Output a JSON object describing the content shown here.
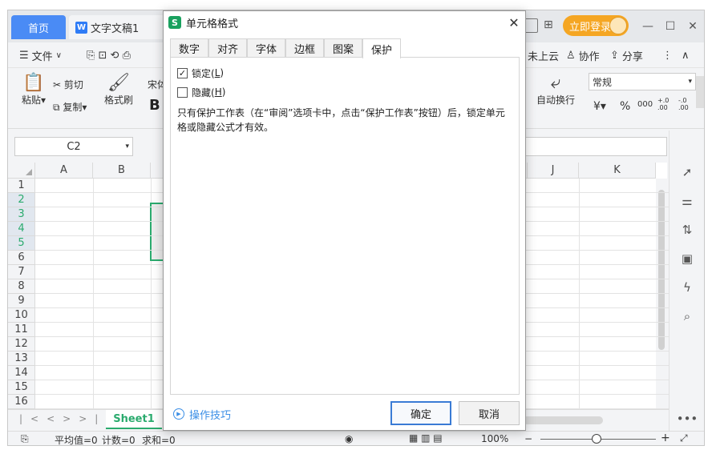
{
  "tabs": {
    "home": "首页",
    "doc": "文字文稿1"
  },
  "titlebar": {
    "login": "立即登录"
  },
  "menu": {
    "file": "文件",
    "cloud": "未上云",
    "collab": "协作",
    "share": "分享"
  },
  "ribbon": {
    "paste": "粘贴",
    "cut": "剪切",
    "copy": "复制",
    "format_painter": "格式刷",
    "font_partial": "宋体",
    "bold": "B",
    "wrap_text": "自动换行",
    "number_format": "常规",
    "currency": "¥",
    "percent": "%",
    "thousands": "000",
    "inc_decimal": "+.0\n.00",
    "dec_decimal": "-.0\n.00"
  },
  "formula": {
    "namebox": "C2"
  },
  "grid": {
    "columns": [
      "A",
      "B",
      "J",
      "K"
    ],
    "rows": [
      "1",
      "2",
      "3",
      "4",
      "5",
      "6",
      "7",
      "8",
      "9",
      "10",
      "11",
      "12",
      "13",
      "14",
      "15",
      "16"
    ],
    "selected_rows": [
      "2",
      "3",
      "4",
      "5"
    ]
  },
  "sheetbar": {
    "sheet1": "Sheet1"
  },
  "statusbar": {
    "avg": "平均值=0",
    "count": "计数=0",
    "sum": "求和=0",
    "zoom": "100%"
  },
  "dialog": {
    "title": "单元格格式",
    "tabs": [
      "数字",
      "对齐",
      "字体",
      "边框",
      "图案",
      "保护"
    ],
    "active_tab": "保护",
    "lock": {
      "label": "锁定(",
      "key": "L",
      "suffix": ")",
      "checked": true
    },
    "hide": {
      "label": "隐藏(",
      "key": "H",
      "suffix": ")",
      "checked": false
    },
    "description": "只有保护工作表（在“审阅”选项卡中，点击“保护工作表”按钮）后，锁定单元格或隐藏公式才有效。",
    "tips": "操作技巧",
    "ok": "确定",
    "cancel": "取消"
  },
  "colors": {
    "accent_green": "#2bab6e",
    "home_tab": "#4a8bf5",
    "login": "#f5a623",
    "primary_border": "#3a7bd5"
  }
}
